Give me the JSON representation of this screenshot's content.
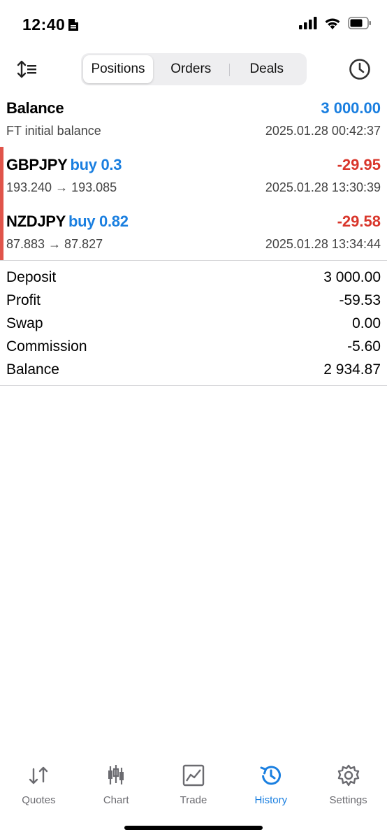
{
  "status": {
    "time": "12:40"
  },
  "toolbar": {
    "tabs": [
      {
        "label": "Positions"
      },
      {
        "label": "Orders"
      },
      {
        "label": "Deals"
      }
    ]
  },
  "balance_row": {
    "title": "Balance",
    "amount": "3 000.00",
    "subtitle": "FT initial balance",
    "datetime": "2025.01.28 00:42:37"
  },
  "positions": [
    {
      "symbol": "GBPJPY",
      "side": "buy 0.3",
      "profit": "-29.95",
      "prices": "193.240 → 193.085",
      "datetime": "2025.01.28 13:30:39"
    },
    {
      "symbol": "NZDJPY",
      "side": "buy 0.82",
      "profit": "-29.58",
      "prices": "87.883 → 87.827",
      "datetime": "2025.01.28 13:34:44"
    }
  ],
  "summary": [
    {
      "label": "Deposit",
      "value": "3 000.00"
    },
    {
      "label": "Profit",
      "value": "-59.53"
    },
    {
      "label": "Swap",
      "value": "0.00"
    },
    {
      "label": "Commission",
      "value": "-5.60"
    },
    {
      "label": "Balance",
      "value": "2 934.87"
    }
  ],
  "tabbar": [
    {
      "label": "Quotes",
      "icon": "quotes-icon"
    },
    {
      "label": "Chart",
      "icon": "chart-icon"
    },
    {
      "label": "Trade",
      "icon": "trade-icon"
    },
    {
      "label": "History",
      "icon": "history-icon"
    },
    {
      "label": "Settings",
      "icon": "settings-icon"
    }
  ],
  "colors": {
    "accent": "#1a7fe0",
    "loss": "#d9362b",
    "loss_bar": "#e0544a"
  }
}
